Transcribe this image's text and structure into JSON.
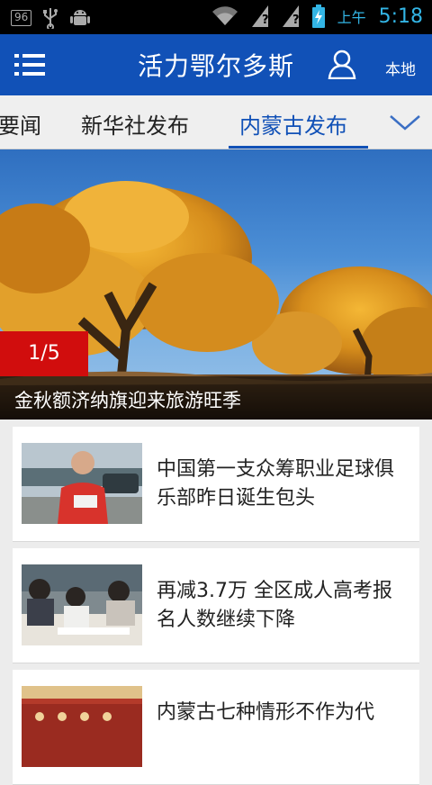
{
  "status_bar": {
    "badge": "96",
    "ampm": "上午",
    "time": "5:18"
  },
  "header": {
    "title": "活力鄂尔多斯",
    "local_label": "本地"
  },
  "tabs": [
    {
      "label": "要闻",
      "active": false
    },
    {
      "label": "新华社发布",
      "active": false
    },
    {
      "label": "内蒙古发布",
      "active": true
    }
  ],
  "hero": {
    "counter": "1/5",
    "caption": "金秋额济纳旗迎来旅游旺季"
  },
  "news": [
    {
      "title": "中国第一支众筹职业足球俱乐部昨日诞生包头"
    },
    {
      "title": "再减3.7万 全区成人高考报名人数继续下降"
    },
    {
      "title": "内蒙古七种情形不作为代"
    }
  ],
  "colors": {
    "brand_blue": "#1151b7",
    "status_accent": "#33b5e5",
    "counter_red": "#d10d0d"
  }
}
